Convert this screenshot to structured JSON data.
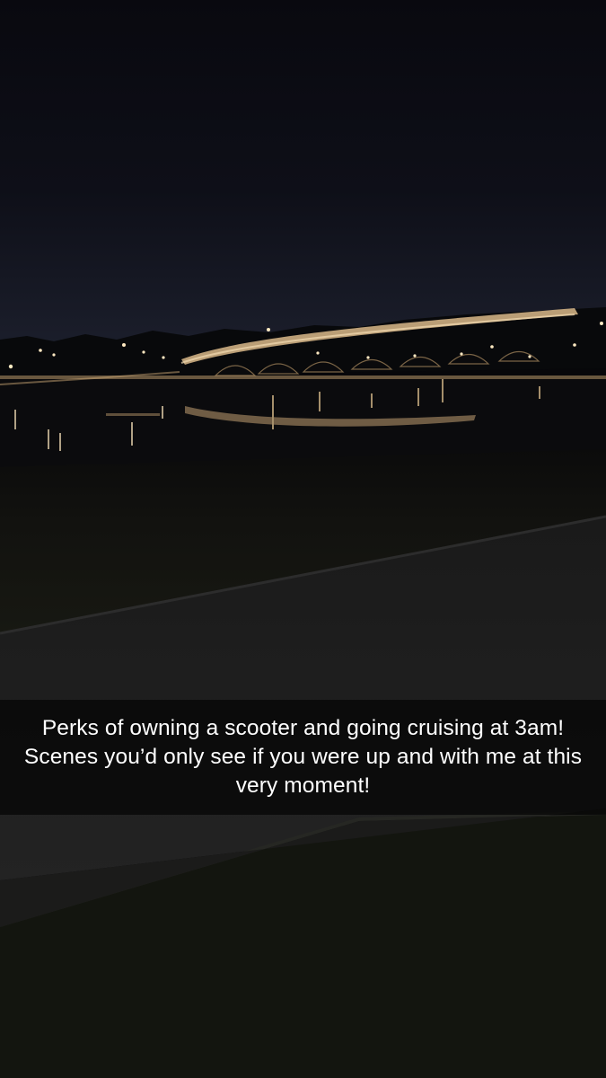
{
  "snap": {
    "caption": "Perks of owning a scooter and going cruising at 3am! Scenes you’d only see if you were up and with me at this very moment!"
  },
  "colors": {
    "sky_top": "#0a0a12",
    "sky_horizon": "#1c1f2e",
    "water": "#0c0c0d",
    "light_glow": "#e8c89a",
    "ground": "#151611",
    "sidewalk": "#1f1f1f",
    "grass": "#14160f",
    "caption_text": "#ffffff"
  },
  "icons": []
}
